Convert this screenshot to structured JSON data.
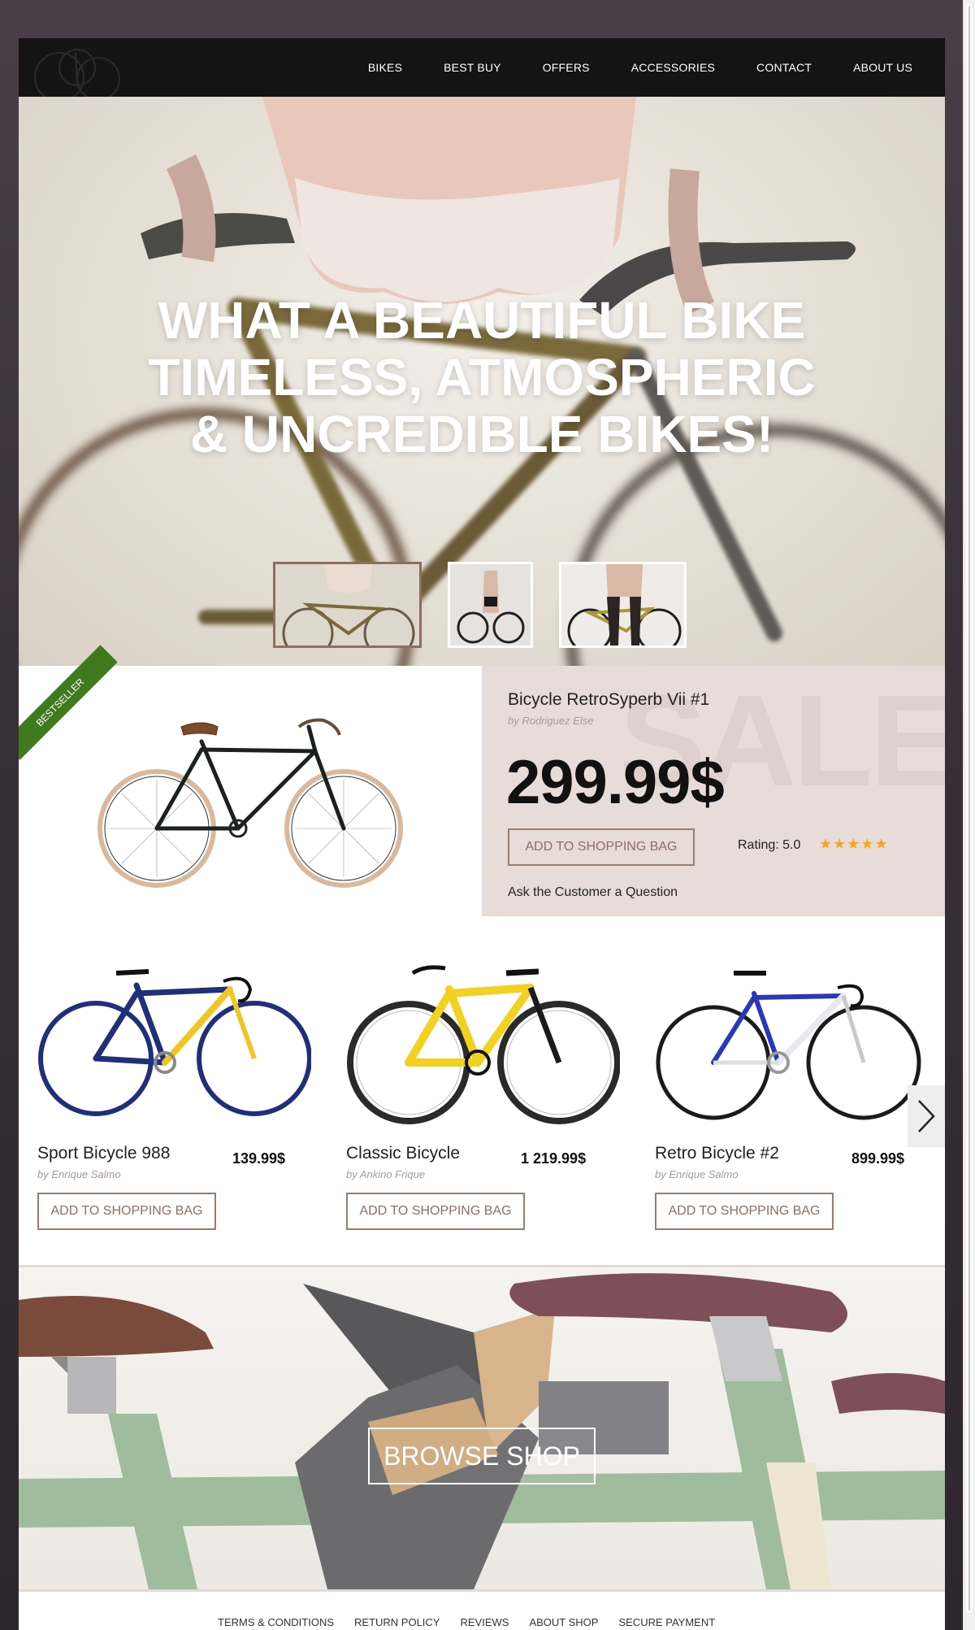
{
  "nav": {
    "items": [
      "BIKES",
      "BEST BUY",
      "OFFERS",
      "ACCESSORIES",
      "CONTACT",
      "ABOUT US"
    ]
  },
  "hero": {
    "lines": [
      "WHAT A BEAUTIFUL BIKE",
      "TIMELESS, ATMOSPHERIC",
      "& UNCREDIBLE BIKES!"
    ],
    "thumbnails_count": 3,
    "active_thumbnail": 1
  },
  "featured": {
    "ribbon": "BESTSELLER",
    "title": "Bicycle RetroSyperb Vii #1",
    "by": "by Rodriguez Else",
    "price": "299.99$",
    "button": "ADD TO SHOPPING BAG",
    "rating_label": "Rating: 5.0",
    "stars": "★★★★★",
    "ask": "Ask the Customer a Question",
    "watermark": "SALE"
  },
  "products": [
    {
      "name": "Sport Bicycle 988",
      "price": "139.99$",
      "by": "by Enrique Salmo",
      "button": "ADD TO SHOPPING BAG",
      "frame_color": "#1f2f7a",
      "accent_color": "#f1c523"
    },
    {
      "name": "Classic Bicycle",
      "price": "1 219.99$",
      "by": "by Ankino Frique",
      "button": "ADD TO SHOPPING BAG",
      "frame_color": "#f3d120",
      "accent_color": "#1a1a1a"
    },
    {
      "name": "Retro Bicycle #2",
      "price": "899.99$",
      "by": "by Enrique Salmo",
      "button": "ADD TO SHOPPING BAG",
      "frame_color": "#2a38b8",
      "accent_color": "#e9e9ee"
    }
  ],
  "browse": {
    "button": "BROWSE SHOP"
  },
  "footer": {
    "links": [
      "TERMS & CONDITIONS",
      "RETURN POLICY",
      "REVIEWS",
      "ABOUT SHOP",
      "SECURE PAYMENT"
    ]
  },
  "colors": {
    "accent": "#9a7c70",
    "ribbon": "#3f7a1f",
    "panel": "#e8dcd9",
    "star": "#f2a81d"
  }
}
